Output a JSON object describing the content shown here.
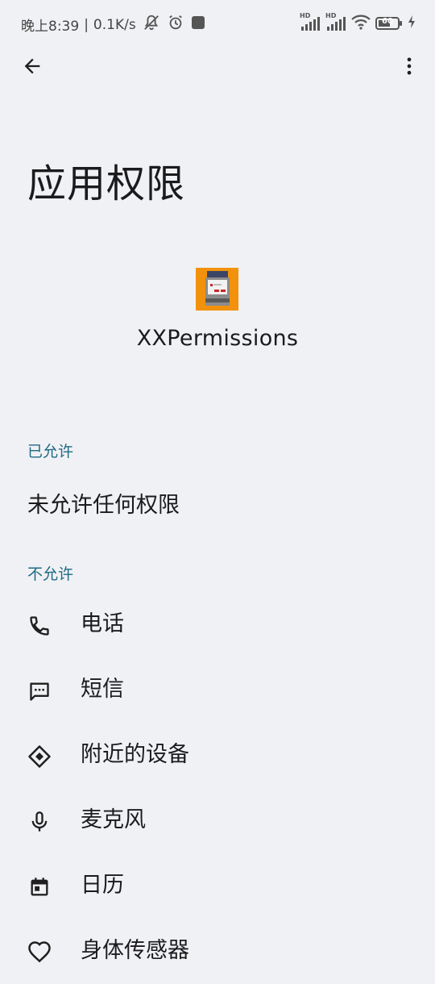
{
  "status_bar": {
    "time": "晚上8:39",
    "separator": "|",
    "net_speed": "0.1K/s",
    "battery_level": "60",
    "icons": [
      "mute-icon",
      "alarm-icon",
      "app-notification-icon",
      "signal-hd-1-icon",
      "signal-hd-2-icon",
      "wifi-icon",
      "battery-icon",
      "charging-icon"
    ],
    "hd_label": "HD"
  },
  "header": {
    "title": "应用权限"
  },
  "app": {
    "name": "XXPermissions",
    "icon_color": "#f2920c"
  },
  "sections": {
    "allowed": {
      "header": "已允许",
      "empty_text": "未允许任何权限"
    },
    "denied": {
      "header": "不允许",
      "items": [
        {
          "label": "电话",
          "icon": "phone-icon"
        },
        {
          "label": "短信",
          "icon": "sms-icon"
        },
        {
          "label": "附近的设备",
          "icon": "nearby-devices-icon"
        },
        {
          "label": "麦克风",
          "icon": "microphone-icon"
        },
        {
          "label": "日历",
          "icon": "calendar-icon"
        },
        {
          "label": "身体传感器",
          "icon": "heart-icon"
        }
      ]
    }
  },
  "colors": {
    "background": "#f0f1f4",
    "section_header": "#1e6a84",
    "text": "#1b1b1d",
    "icon": "#1f1f1f"
  }
}
